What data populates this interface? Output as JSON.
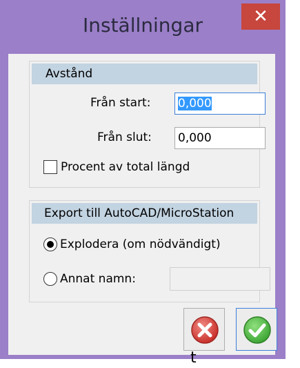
{
  "window": {
    "title": "Inställningar",
    "close_glyph": "✕"
  },
  "distance_group": {
    "header": "Avstånd",
    "from_start_label": "Från start:",
    "from_start_value": "0,000",
    "from_end_label": "Från slut:",
    "from_end_value": "0,000",
    "percent_checkbox_label": "Procent av total längd",
    "percent_checked": false
  },
  "export_group": {
    "header": "Export till AutoCAD/MicroStation",
    "explode_label": "Explodera (om nödvändigt)",
    "explode_selected": true,
    "other_name_label": "Annat namn:",
    "other_name_value": "",
    "other_name_selected": false
  },
  "buttons": {
    "cancel_icon": "cancel-x-icon",
    "ok_icon": "checkmark-icon"
  },
  "stray_text": "t",
  "colors": {
    "window_frame": "#9b7fc8",
    "close_button": "#c7463d",
    "group_header": "#c2d3e1",
    "focus_border": "#3c7fd8",
    "selection": "#3399ff"
  }
}
